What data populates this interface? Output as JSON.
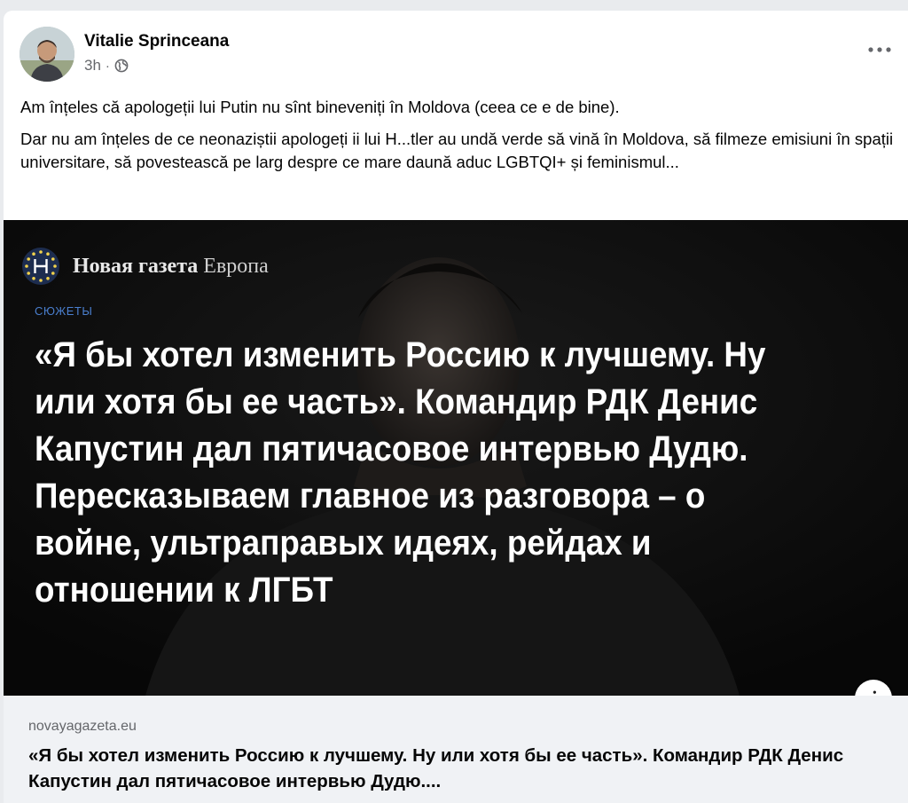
{
  "post": {
    "author": "Vitalie Sprinceana",
    "time": "3h",
    "separator": "·",
    "privacy_icon": "globe-icon",
    "more_icon": "more-horizontal-icon",
    "paragraphs": [
      "Am înțeles că apologeții lui Putin nu sînt bineveniți în Moldova (ceea ce e de bine).",
      "Dar nu am înțeles de ce neonaziștii apologeți ii lui H...tler au undă verde să vină în Moldova, să filmeze emisiuni în spații universitare, să povestească pe larg despre ce mare daună aduc LGBTQI+ și feminismul..."
    ]
  },
  "link_preview": {
    "image": {
      "brand_bold": "Новая газета",
      "brand_light": "Европа",
      "rubric": "СЮЖЕТЫ",
      "headline": "«Я бы хотел изменить Россию к лучшему. Ну или хотя бы ее часть». Командир РДК Денис Капустин дал пятичасовое интервью Дудю. Пересказываем главное из разговора – о войне, ультраправых идеях, рейдах и отношении к ЛГБТ"
    },
    "info_label": "i",
    "domain": "novayagazeta.eu",
    "title": "«Я бы хотел изменить Россию к лучшему. Ну или хотя бы ее часть». Командир РДК Денис Капустин дал пятичасовое интервью Дудю...."
  },
  "colors": {
    "page_bg": "#e9ebee",
    "card_bg": "#ffffff",
    "text_primary": "#050505",
    "text_secondary": "#65676b",
    "preview_footer_bg": "#f0f2f5",
    "rubric_blue": "#4a7fcf"
  }
}
